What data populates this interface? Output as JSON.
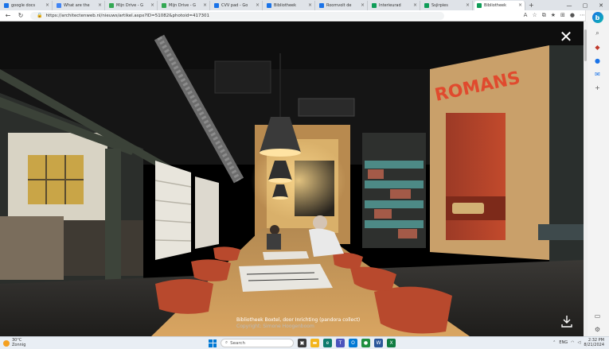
{
  "browser": {
    "tabs": [
      {
        "label": "google docs",
        "color": "#1a73e8"
      },
      {
        "label": "What are the",
        "color": "#4285f4"
      },
      {
        "label": "Mijn Drive - G",
        "color": "#34a853"
      },
      {
        "label": "Mijn Drive - G",
        "color": "#34a853"
      },
      {
        "label": "CVV pad - Go",
        "color": "#1a73e8"
      },
      {
        "label": "Bibliotheek",
        "color": "#1a73e8"
      },
      {
        "label": "Roomvolt de",
        "color": "#1a73e8"
      },
      {
        "label": "Interieurad",
        "color": "#0f9d58"
      },
      {
        "label": "Ssjirpies",
        "color": "#0f9d58"
      },
      {
        "label": "Bibliotheek",
        "color": "#0f9d58",
        "active": true
      }
    ],
    "new_tab": "+",
    "url": "https://architectenweb.nl/nieuws/artikel.aspx?ID=51082&photoid=417301",
    "window_controls": {
      "minimize": "—",
      "maximize": "▢",
      "close": "✕"
    }
  },
  "viewer": {
    "close_glyph": "✕",
    "caption_title": "Bibliotheek Boxtel, door Inrichting (pandora collect)",
    "caption_credit": "Copyright: Simone Hoogenboom",
    "photo": {
      "shelf_sign": "ROMANS"
    }
  },
  "taskbar": {
    "weather_temp": "30°C",
    "weather_desc": "Zonnig",
    "search_placeholder": "Search",
    "time": "2:32 PM",
    "date": "8/21/2024",
    "lang": "ENG"
  }
}
